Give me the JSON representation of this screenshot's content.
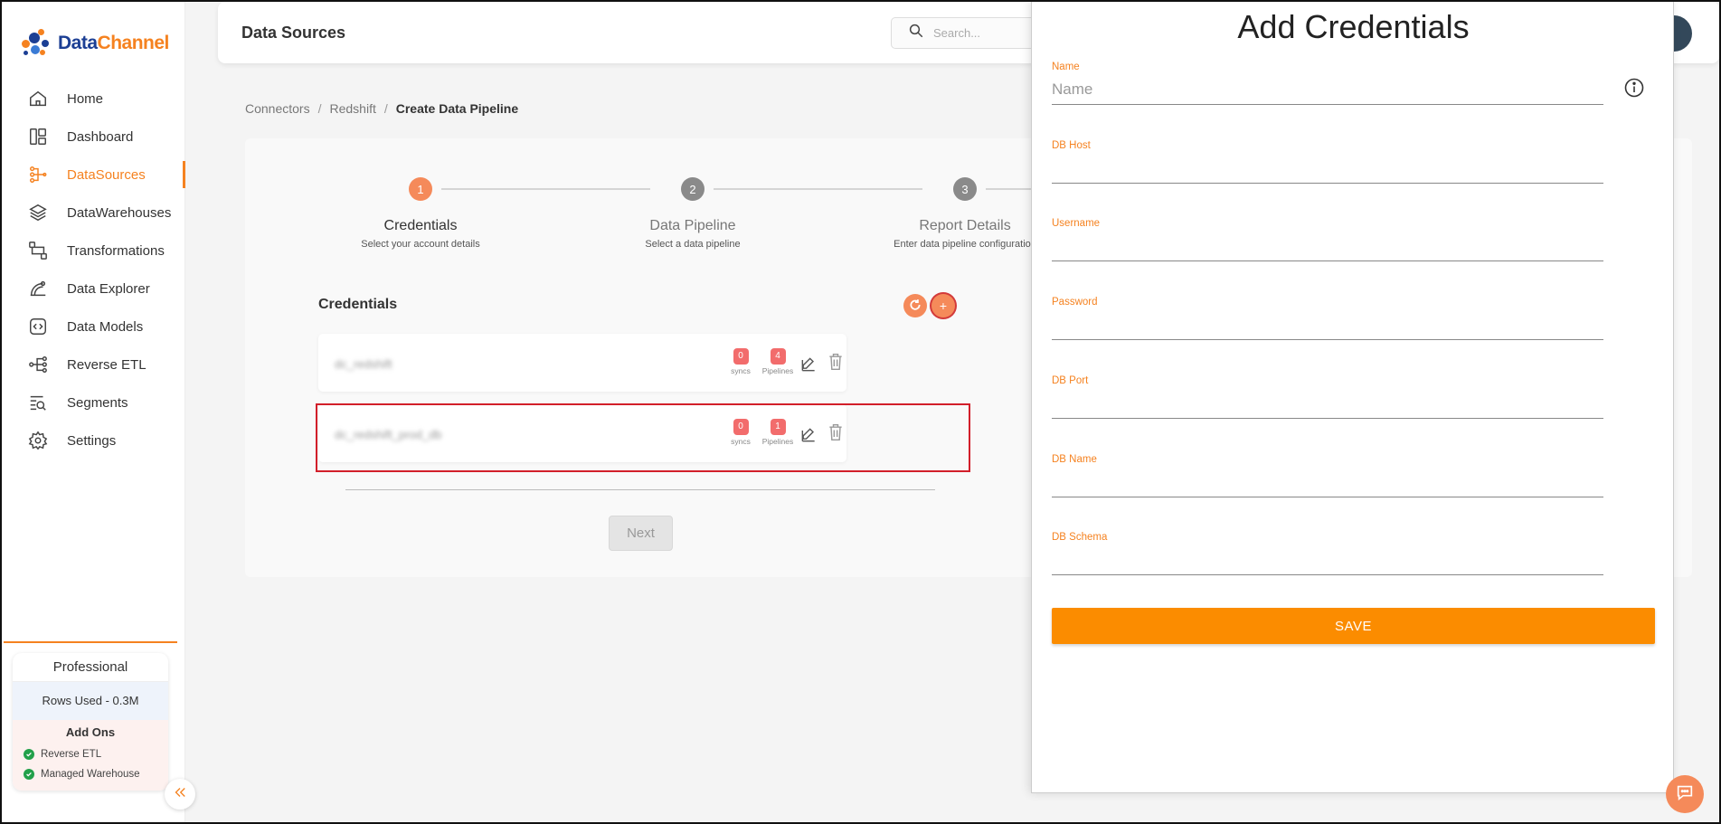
{
  "app": {
    "logo_part1": "Data",
    "logo_part2": "Channel",
    "accent": "#f58220"
  },
  "sidebar": {
    "items": [
      {
        "label": "Home",
        "icon": "home-icon",
        "active": false
      },
      {
        "label": "Dashboard",
        "icon": "dashboard-icon",
        "active": false
      },
      {
        "label": "DataSources",
        "icon": "datasources-icon",
        "active": true
      },
      {
        "label": "DataWarehouses",
        "icon": "datawarehouses-icon",
        "active": false
      },
      {
        "label": "Transformations",
        "icon": "transformations-icon",
        "active": false
      },
      {
        "label": "Data Explorer",
        "icon": "data-explorer-icon",
        "active": false
      },
      {
        "label": "Data Models",
        "icon": "data-models-icon",
        "active": false
      },
      {
        "label": "Reverse ETL",
        "icon": "reverse-etl-icon",
        "active": false
      },
      {
        "label": "Segments",
        "icon": "segments-icon",
        "active": false
      },
      {
        "label": "Settings",
        "icon": "settings-icon",
        "active": false
      }
    ],
    "plan": {
      "name": "Professional",
      "rows_used": "Rows Used - 0.3M",
      "addons_title": "Add Ons",
      "addons": [
        "Reverse ETL",
        "Managed Warehouse"
      ]
    }
  },
  "header": {
    "title": "Data Sources",
    "search_placeholder": "Search..."
  },
  "breadcrumb": {
    "items": [
      "Connectors",
      "Redshift",
      "Create Data Pipeline"
    ],
    "separator": "/"
  },
  "stepper": {
    "steps": [
      {
        "number": "1",
        "title": "Credentials",
        "subtitle": "Select your account details",
        "active": true
      },
      {
        "number": "2",
        "title": "Data Pipeline",
        "subtitle": "Select a data pipeline",
        "active": false
      },
      {
        "number": "3",
        "title": "Report Details",
        "subtitle": "Enter data pipeline configuration",
        "active": false
      }
    ]
  },
  "credentials": {
    "title": "Credentials",
    "add_label": "+",
    "rows": [
      {
        "name": "dc_redshift",
        "syncs": "0",
        "syncs_label": "syncs",
        "pipelines": "4",
        "pipelines_label": "Pipelines"
      },
      {
        "name": "dc_redshift_prod_db",
        "syncs": "0",
        "syncs_label": "syncs",
        "pipelines": "1",
        "pipelines_label": "Pipelines"
      }
    ],
    "next_label": "Next"
  },
  "drawer": {
    "title": "Add Credentials",
    "fields": [
      {
        "label": "Name",
        "placeholder": "Name",
        "value": ""
      },
      {
        "label": "DB Host",
        "placeholder": "",
        "value": ""
      },
      {
        "label": "Username",
        "placeholder": "",
        "value": ""
      },
      {
        "label": "Password",
        "placeholder": "",
        "value": ""
      },
      {
        "label": "DB Port",
        "placeholder": "",
        "value": ""
      },
      {
        "label": "DB Name",
        "placeholder": "",
        "value": ""
      },
      {
        "label": "DB Schema",
        "placeholder": "",
        "value": ""
      }
    ],
    "save_label": "SAVE"
  }
}
